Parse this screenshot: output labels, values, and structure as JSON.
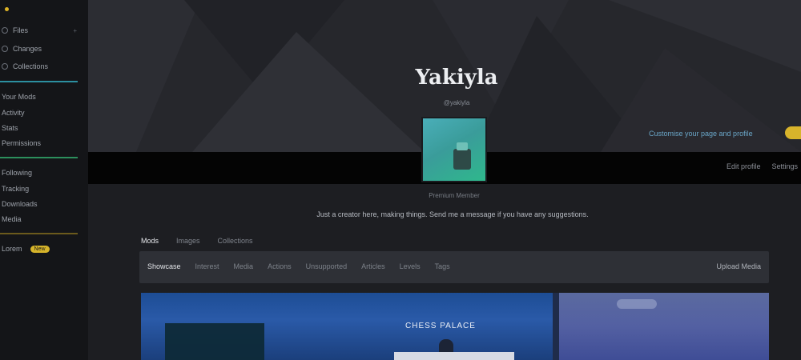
{
  "sidebar": {
    "top_label": "",
    "items": [
      {
        "label": "Files",
        "count": "+"
      },
      {
        "label": "Changes"
      },
      {
        "label": "Collections"
      }
    ],
    "section2": [
      "Your Mods",
      "Activity",
      "Stats",
      "Permissions"
    ],
    "section3": [
      "Following",
      "Tracking",
      "Downloads",
      "Media"
    ],
    "footer_label": "Lorem",
    "footer_badge": "New",
    "accent_color": "#d6b42a",
    "separator_color": "#2c8fa0"
  },
  "banner": {
    "title": "Yakiyla",
    "subtitle": "@yakiyla",
    "link": "Customise your page and profile",
    "pill_color": "#d8b42b"
  },
  "strip": {
    "actions": [
      "Edit profile",
      "Settings"
    ]
  },
  "profile": {
    "caption": "Premium Member",
    "description": "Just a creator here, making things. Send me a message if you have any suggestions."
  },
  "tabs": [
    "Mods",
    "Images",
    "Collections"
  ],
  "toolbar": {
    "items": [
      "Showcase",
      "Interest",
      "Media",
      "Actions",
      "Unsupported",
      "Articles",
      "Levels",
      "Tags"
    ],
    "right_label": "Upload Media"
  },
  "preview": {
    "left_text": "CHESS PALACE"
  }
}
